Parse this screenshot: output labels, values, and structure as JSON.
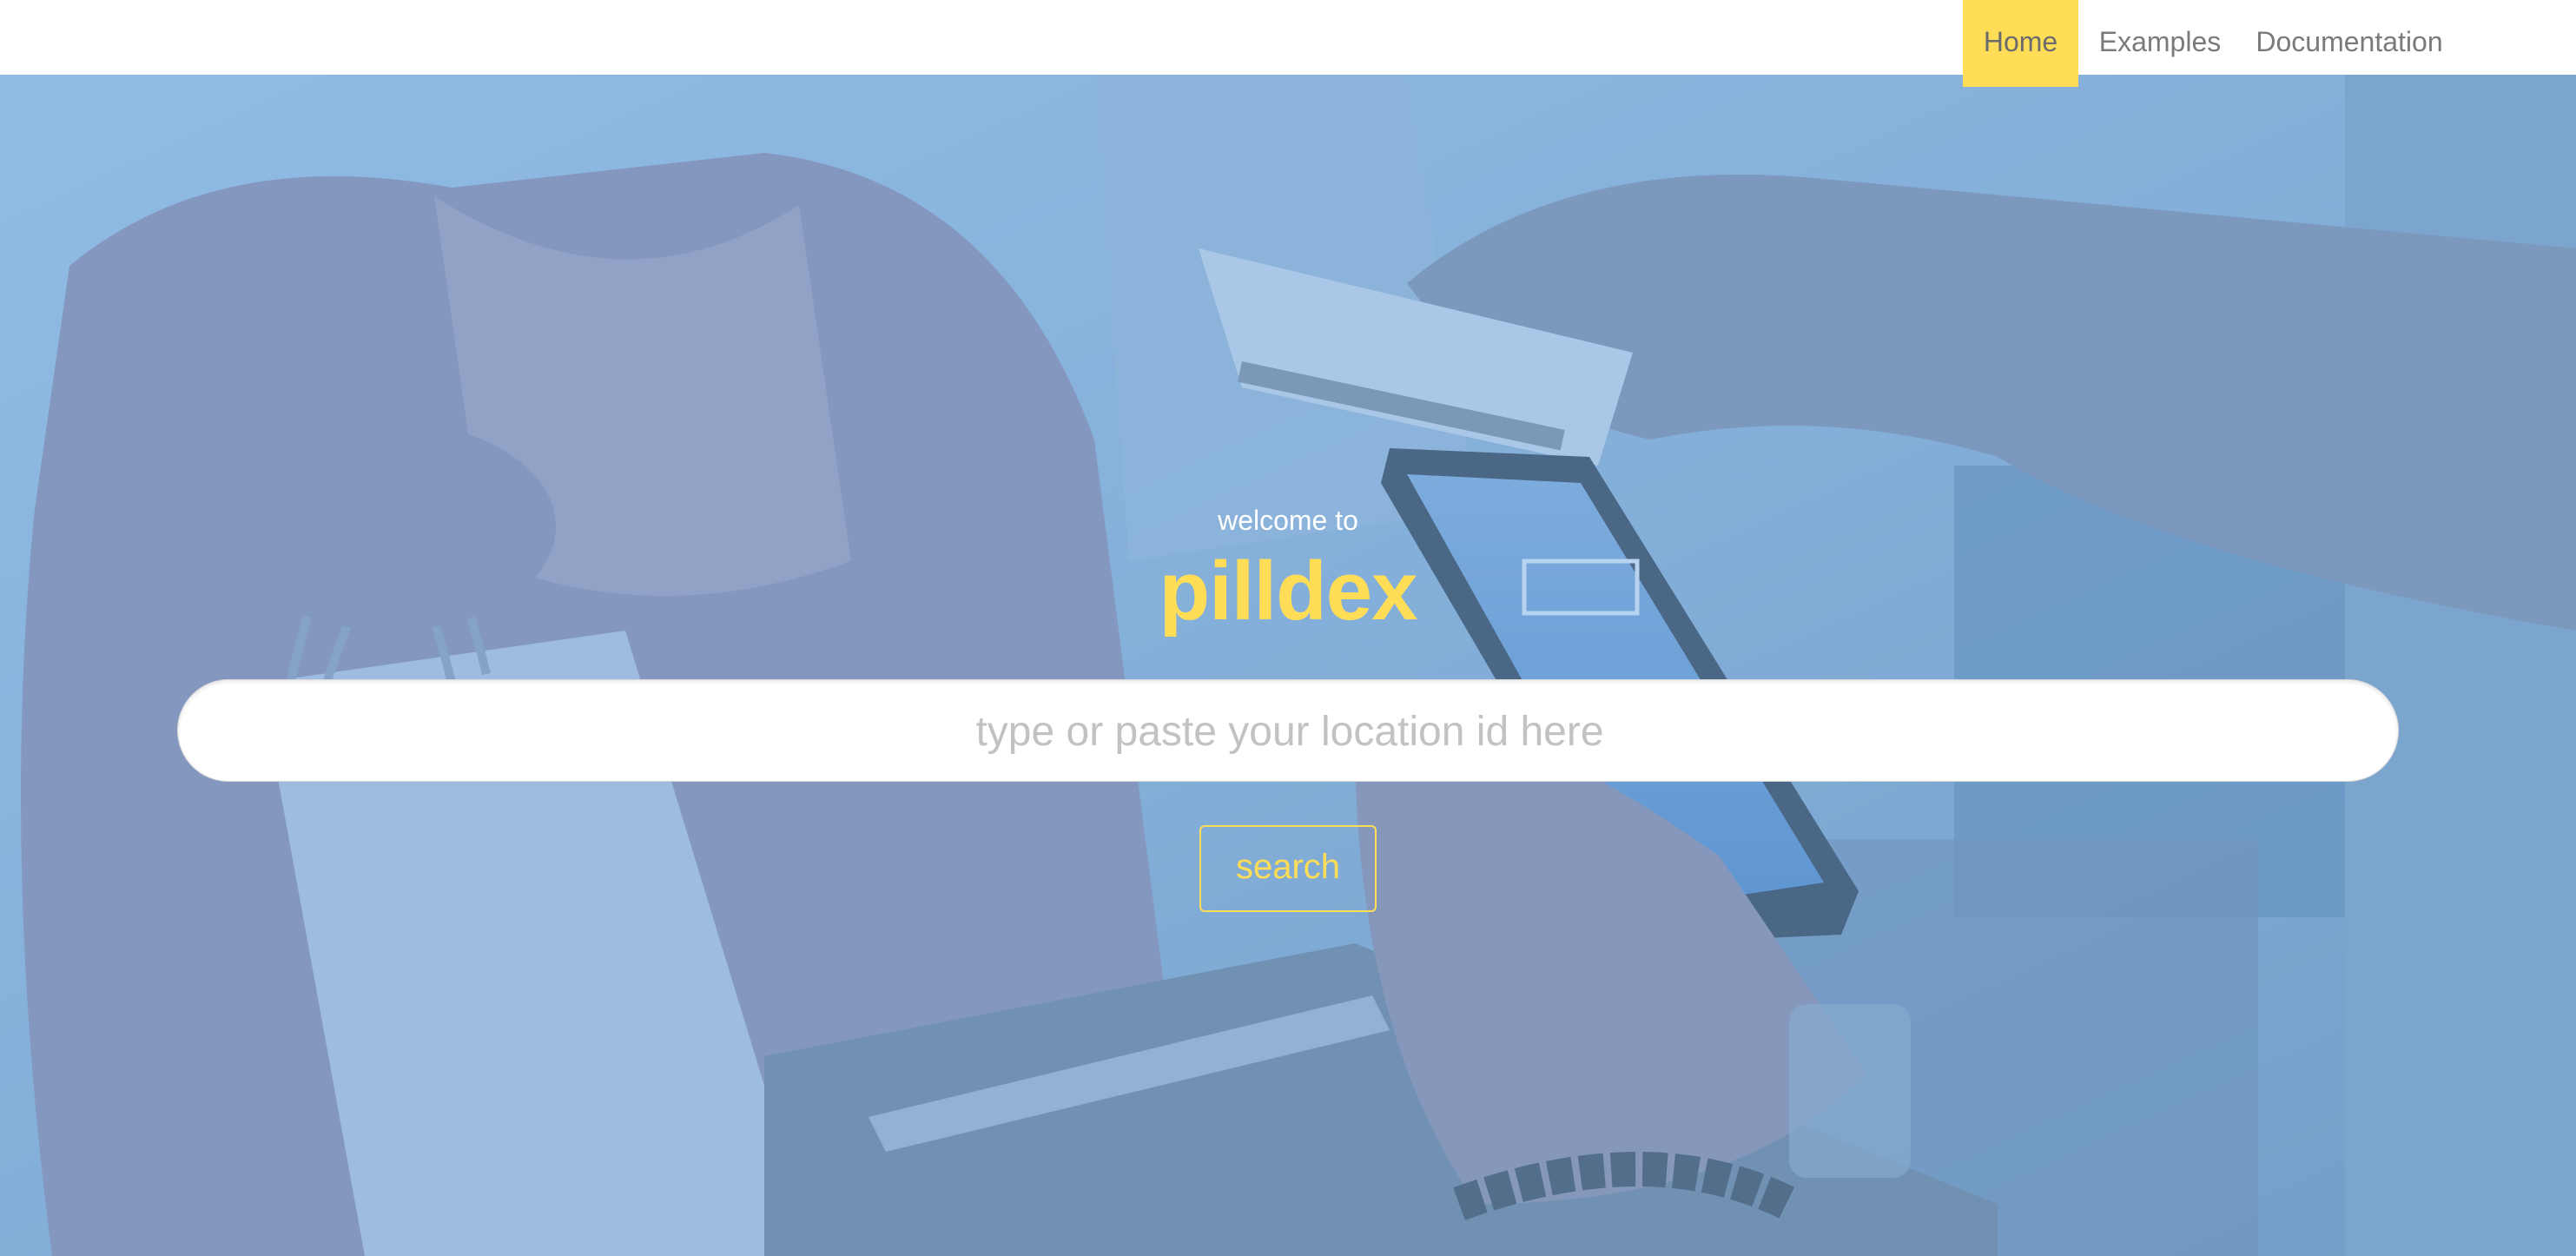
{
  "navbar": {
    "links": [
      {
        "label": "Home",
        "active": true
      },
      {
        "label": "Examples",
        "active": false
      },
      {
        "label": "Documentation",
        "active": false
      }
    ]
  },
  "hero": {
    "welcome_text": "welcome to",
    "brand_name": "pilldex",
    "search": {
      "placeholder": "type or paste your location id here",
      "value": ""
    },
    "search_button_label": "search",
    "background_image": "checkout-payment-photo"
  },
  "colors": {
    "accent": "#ffdd57",
    "overlay": "#78afe6",
    "nav_text": "#7a7a7a"
  }
}
